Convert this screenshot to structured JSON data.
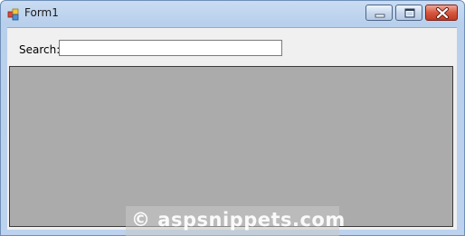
{
  "window": {
    "title": "Form1"
  },
  "icons": {
    "app": "form-app-icon",
    "minimize": "minimize-icon",
    "maximize": "maximize-icon",
    "close": "close-icon"
  },
  "search": {
    "label": "Search:",
    "value": ""
  },
  "grid": {
    "rows": []
  },
  "watermark": {
    "text": "© aspsnippets.com"
  },
  "colors": {
    "grid_background": "#ababab",
    "client_background": "#f0f0f0",
    "titlebar": "#c9dcf2",
    "close_button": "#c13a22"
  }
}
